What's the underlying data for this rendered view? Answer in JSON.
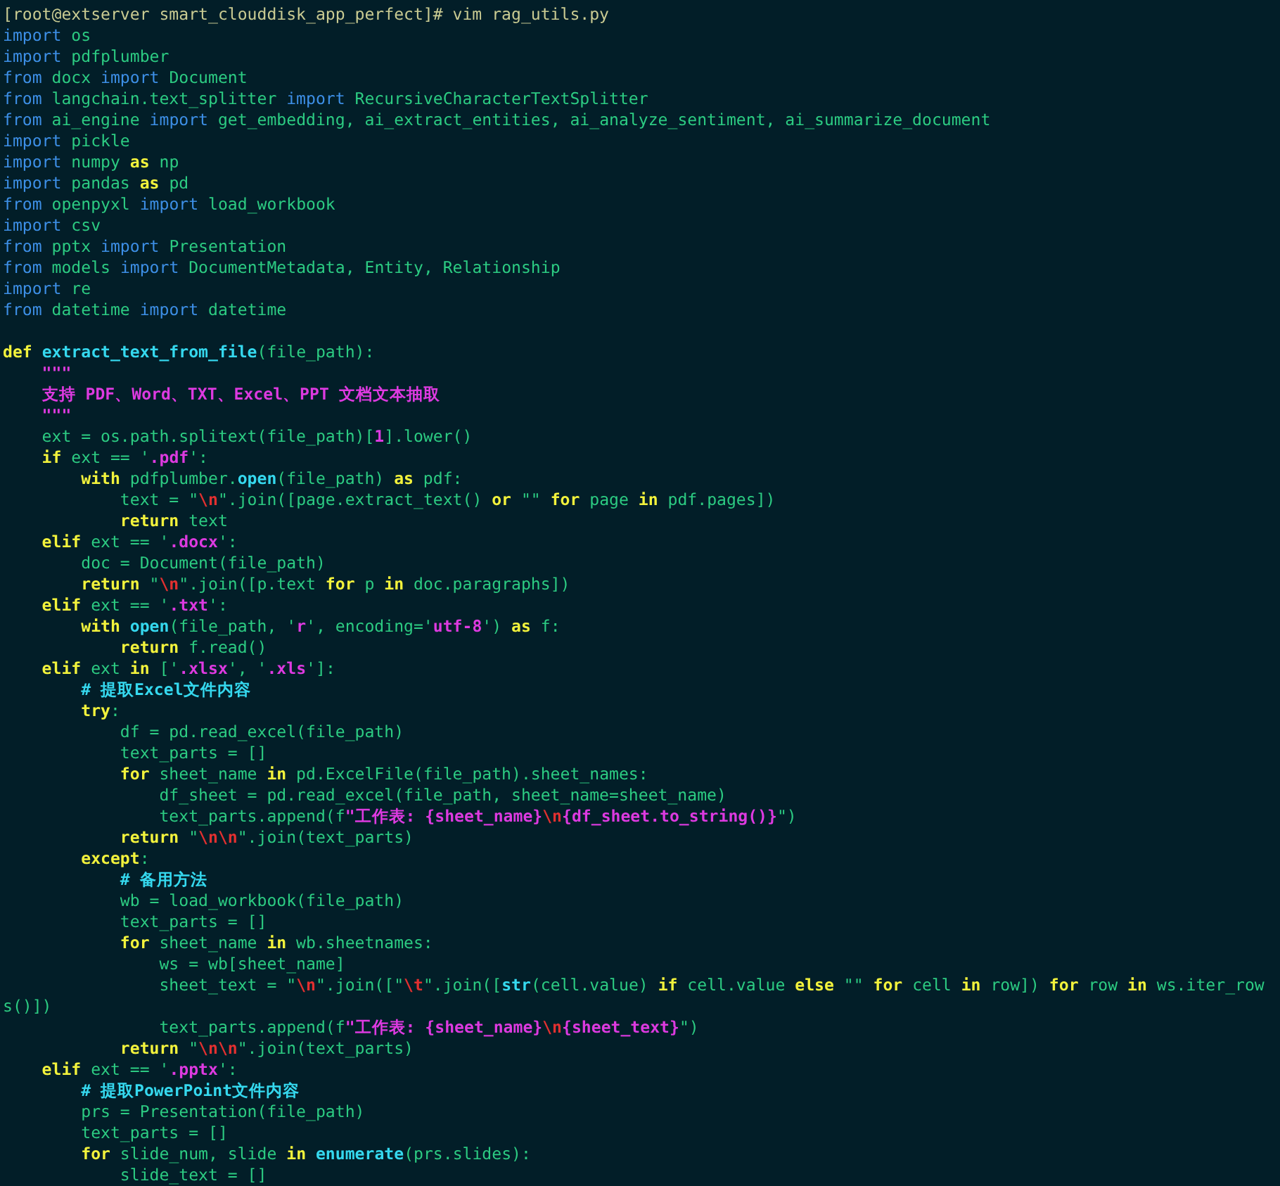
{
  "terminal": {
    "lines": [
      {
        "tokens": [
          {
            "text": "[root@extserver smart_clouddisk_app_perfect]# vim rag_utils.py",
            "kind": "prompt"
          }
        ]
      },
      {
        "tokens": [
          {
            "text": "import",
            "kind": "keyword"
          },
          {
            "text": " os",
            "kind": "plain"
          }
        ]
      },
      {
        "tokens": [
          {
            "text": "import",
            "kind": "keyword"
          },
          {
            "text": " pdfplumber",
            "kind": "plain"
          }
        ]
      },
      {
        "tokens": [
          {
            "text": "from",
            "kind": "keyword"
          },
          {
            "text": " docx ",
            "kind": "plain"
          },
          {
            "text": "import",
            "kind": "keyword"
          },
          {
            "text": " Document",
            "kind": "plain"
          }
        ]
      },
      {
        "tokens": [
          {
            "text": "from",
            "kind": "keyword"
          },
          {
            "text": " langchain.text_splitter ",
            "kind": "plain"
          },
          {
            "text": "import",
            "kind": "keyword"
          },
          {
            "text": " RecursiveCharacterTextSplitter",
            "kind": "plain"
          }
        ]
      },
      {
        "tokens": [
          {
            "text": "from",
            "kind": "keyword"
          },
          {
            "text": " ai_engine ",
            "kind": "plain"
          },
          {
            "text": "import",
            "kind": "keyword"
          },
          {
            "text": " get_embedding, ai_extract_entities, ai_analyze_sentiment, ai_summarize_document",
            "kind": "plain"
          }
        ]
      },
      {
        "tokens": [
          {
            "text": "import",
            "kind": "keyword"
          },
          {
            "text": " pickle",
            "kind": "plain"
          }
        ]
      },
      {
        "tokens": [
          {
            "text": "import",
            "kind": "keyword"
          },
          {
            "text": " numpy ",
            "kind": "plain"
          },
          {
            "text": "as",
            "kind": "statement"
          },
          {
            "text": " np",
            "kind": "plain"
          }
        ]
      },
      {
        "tokens": [
          {
            "text": "import",
            "kind": "keyword"
          },
          {
            "text": " pandas ",
            "kind": "plain"
          },
          {
            "text": "as",
            "kind": "statement"
          },
          {
            "text": " pd",
            "kind": "plain"
          }
        ]
      },
      {
        "tokens": [
          {
            "text": "from",
            "kind": "keyword"
          },
          {
            "text": " openpyxl ",
            "kind": "plain"
          },
          {
            "text": "import",
            "kind": "keyword"
          },
          {
            "text": " load_workbook",
            "kind": "plain"
          }
        ]
      },
      {
        "tokens": [
          {
            "text": "import",
            "kind": "keyword"
          },
          {
            "text": " csv",
            "kind": "plain"
          }
        ]
      },
      {
        "tokens": [
          {
            "text": "from",
            "kind": "keyword"
          },
          {
            "text": " pptx ",
            "kind": "plain"
          },
          {
            "text": "import",
            "kind": "keyword"
          },
          {
            "text": " Presentation",
            "kind": "plain"
          }
        ]
      },
      {
        "tokens": [
          {
            "text": "from",
            "kind": "keyword"
          },
          {
            "text": " models ",
            "kind": "plain"
          },
          {
            "text": "import",
            "kind": "keyword"
          },
          {
            "text": " DocumentMetadata, Entity, Relationship",
            "kind": "plain"
          }
        ]
      },
      {
        "tokens": [
          {
            "text": "import",
            "kind": "keyword"
          },
          {
            "text": " re",
            "kind": "plain"
          }
        ]
      },
      {
        "tokens": [
          {
            "text": "from",
            "kind": "keyword"
          },
          {
            "text": " datetime ",
            "kind": "plain"
          },
          {
            "text": "import",
            "kind": "keyword"
          },
          {
            "text": " datetime",
            "kind": "plain"
          }
        ],
        "blank_line_after": true
      },
      {
        "tokens": [
          {
            "text": "def ",
            "kind": "statement"
          },
          {
            "text": "extract_text_from_file",
            "kind": "function"
          },
          {
            "text": "(file_path):",
            "kind": "plain"
          }
        ]
      },
      {
        "tokens": [
          {
            "text": "    \"\"\"",
            "kind": "string"
          }
        ]
      },
      {
        "tokens": [
          {
            "text": "    支持 PDF、Word、TXT、Excel、PPT 文档文本抽取",
            "kind": "string"
          }
        ]
      },
      {
        "tokens": [
          {
            "text": "    \"\"\"",
            "kind": "string"
          }
        ]
      },
      {
        "tokens": [
          {
            "text": "    ext = os.path.splitext(file_path)[",
            "kind": "plain"
          },
          {
            "text": "1",
            "kind": "string"
          },
          {
            "text": "].lower()",
            "kind": "plain"
          }
        ]
      },
      {
        "tokens": [
          {
            "text": "    if",
            "kind": "statement"
          },
          {
            "text": " ext == '",
            "kind": "plain"
          },
          {
            "text": ".pdf",
            "kind": "string"
          },
          {
            "text": "':",
            "kind": "plain"
          }
        ]
      },
      {
        "tokens": [
          {
            "text": "        with",
            "kind": "statement"
          },
          {
            "text": " pdfplumber.",
            "kind": "plain"
          },
          {
            "text": "open",
            "kind": "function"
          },
          {
            "text": "(file_path) ",
            "kind": "plain"
          },
          {
            "text": "as",
            "kind": "statement"
          },
          {
            "text": " pdf:",
            "kind": "plain"
          }
        ]
      },
      {
        "tokens": [
          {
            "text": "            text = \"",
            "kind": "plain"
          },
          {
            "text": "\\n",
            "kind": "escape"
          },
          {
            "text": "\".join([page.extract_text() ",
            "kind": "plain"
          },
          {
            "text": "or",
            "kind": "statement"
          },
          {
            "text": " \"\" ",
            "kind": "plain"
          },
          {
            "text": "for",
            "kind": "statement"
          },
          {
            "text": " page ",
            "kind": "plain"
          },
          {
            "text": "in",
            "kind": "statement"
          },
          {
            "text": " pdf.pages])",
            "kind": "plain"
          }
        ]
      },
      {
        "tokens": [
          {
            "text": "            return",
            "kind": "statement"
          },
          {
            "text": " text",
            "kind": "plain"
          }
        ]
      },
      {
        "tokens": [
          {
            "text": "    elif",
            "kind": "statement"
          },
          {
            "text": " ext == '",
            "kind": "plain"
          },
          {
            "text": ".docx",
            "kind": "string"
          },
          {
            "text": "':",
            "kind": "plain"
          }
        ]
      },
      {
        "tokens": [
          {
            "text": "        doc = Document(file_path)",
            "kind": "plain"
          }
        ]
      },
      {
        "tokens": [
          {
            "text": "        return",
            "kind": "statement"
          },
          {
            "text": " \"",
            "kind": "plain"
          },
          {
            "text": "\\n",
            "kind": "escape"
          },
          {
            "text": "\".join([p.text ",
            "kind": "plain"
          },
          {
            "text": "for",
            "kind": "statement"
          },
          {
            "text": " p ",
            "kind": "plain"
          },
          {
            "text": "in",
            "kind": "statement"
          },
          {
            "text": " doc.paragraphs])",
            "kind": "plain"
          }
        ]
      },
      {
        "tokens": [
          {
            "text": "    elif",
            "kind": "statement"
          },
          {
            "text": " ext == '",
            "kind": "plain"
          },
          {
            "text": ".txt",
            "kind": "string"
          },
          {
            "text": "':",
            "kind": "plain"
          }
        ]
      },
      {
        "tokens": [
          {
            "text": "        with",
            "kind": "statement"
          },
          {
            "text": " open",
            "kind": "function"
          },
          {
            "text": "(file_path, '",
            "kind": "plain"
          },
          {
            "text": "r",
            "kind": "string"
          },
          {
            "text": "', encoding='",
            "kind": "plain"
          },
          {
            "text": "utf-8",
            "kind": "string"
          },
          {
            "text": "') ",
            "kind": "plain"
          },
          {
            "text": "as",
            "kind": "statement"
          },
          {
            "text": " f:",
            "kind": "plain"
          }
        ]
      },
      {
        "tokens": [
          {
            "text": "            return",
            "kind": "statement"
          },
          {
            "text": " f.read()",
            "kind": "plain"
          }
        ]
      },
      {
        "tokens": [
          {
            "text": "    elif",
            "kind": "statement"
          },
          {
            "text": " ext ",
            "kind": "plain"
          },
          {
            "text": "in",
            "kind": "statement"
          },
          {
            "text": " ['",
            "kind": "plain"
          },
          {
            "text": ".xlsx",
            "kind": "string"
          },
          {
            "text": "', '",
            "kind": "plain"
          },
          {
            "text": ".xls",
            "kind": "string"
          },
          {
            "text": "']:",
            "kind": "plain"
          }
        ]
      },
      {
        "tokens": [
          {
            "text": "        # 提取Excel文件内容",
            "kind": "comment"
          }
        ]
      },
      {
        "tokens": [
          {
            "text": "        try",
            "kind": "statement"
          },
          {
            "text": ":",
            "kind": "plain"
          }
        ]
      },
      {
        "tokens": [
          {
            "text": "            df = pd.read_excel(file_path)",
            "kind": "plain"
          }
        ]
      },
      {
        "tokens": [
          {
            "text": "            text_parts = []",
            "kind": "plain"
          }
        ]
      },
      {
        "tokens": [
          {
            "text": "            for",
            "kind": "statement"
          },
          {
            "text": " sheet_name ",
            "kind": "plain"
          },
          {
            "text": "in",
            "kind": "statement"
          },
          {
            "text": " pd.ExcelFile(file_path).sheet_names:",
            "kind": "plain"
          }
        ]
      },
      {
        "tokens": [
          {
            "text": "                df_sheet = pd.read_excel(file_path, sheet_name=sheet_name)",
            "kind": "plain"
          }
        ]
      },
      {
        "tokens": [
          {
            "text": "                text_parts.append(f",
            "kind": "plain"
          },
          {
            "text": "\"工作表: {sheet_name}",
            "kind": "string"
          },
          {
            "text": "\\n",
            "kind": "escape"
          },
          {
            "text": "{df_sheet.to_string()}",
            "kind": "string"
          },
          {
            "text": "\")",
            "kind": "plain"
          }
        ]
      },
      {
        "tokens": [
          {
            "text": "            return",
            "kind": "statement"
          },
          {
            "text": " \"",
            "kind": "plain"
          },
          {
            "text": "\\n\\n",
            "kind": "escape"
          },
          {
            "text": "\".join(text_parts)",
            "kind": "plain"
          }
        ]
      },
      {
        "tokens": [
          {
            "text": "        except",
            "kind": "statement"
          },
          {
            "text": ":",
            "kind": "plain"
          }
        ]
      },
      {
        "tokens": [
          {
            "text": "            # 备用方法",
            "kind": "comment"
          }
        ]
      },
      {
        "tokens": [
          {
            "text": "            wb = load_workbook(file_path)",
            "kind": "plain"
          }
        ]
      },
      {
        "tokens": [
          {
            "text": "            text_parts = []",
            "kind": "plain"
          }
        ]
      },
      {
        "tokens": [
          {
            "text": "            for",
            "kind": "statement"
          },
          {
            "text": " sheet_name ",
            "kind": "plain"
          },
          {
            "text": "in",
            "kind": "statement"
          },
          {
            "text": " wb.sheetnames:",
            "kind": "plain"
          }
        ]
      },
      {
        "tokens": [
          {
            "text": "                ws = wb[sheet_name]",
            "kind": "plain"
          }
        ]
      },
      {
        "tokens": [
          {
            "text": "                sheet_text = \"",
            "kind": "plain"
          },
          {
            "text": "\\n",
            "kind": "escape"
          },
          {
            "text": "\".join([\"",
            "kind": "plain"
          },
          {
            "text": "\\t",
            "kind": "escape"
          },
          {
            "text": "\".join([",
            "kind": "plain"
          },
          {
            "text": "str",
            "kind": "function"
          },
          {
            "text": "(cell.value) ",
            "kind": "plain"
          },
          {
            "text": "if",
            "kind": "statement"
          },
          {
            "text": " cell.value ",
            "kind": "plain"
          },
          {
            "text": "else",
            "kind": "statement"
          },
          {
            "text": " \"\" ",
            "kind": "plain"
          },
          {
            "text": "for",
            "kind": "statement"
          },
          {
            "text": " cell ",
            "kind": "plain"
          },
          {
            "text": "in",
            "kind": "statement"
          },
          {
            "text": " row]) ",
            "kind": "plain"
          },
          {
            "text": "for",
            "kind": "statement"
          },
          {
            "text": " row ",
            "kind": "plain"
          },
          {
            "text": "in",
            "kind": "statement"
          },
          {
            "text": " ws.iter_row",
            "kind": "plain"
          }
        ]
      },
      {
        "tokens": [
          {
            "text": "s()])",
            "kind": "plain"
          }
        ]
      },
      {
        "tokens": [
          {
            "text": "                text_parts.append(f",
            "kind": "plain"
          },
          {
            "text": "\"工作表: {sheet_name}",
            "kind": "string"
          },
          {
            "text": "\\n",
            "kind": "escape"
          },
          {
            "text": "{sheet_text}",
            "kind": "string"
          },
          {
            "text": "\")",
            "kind": "plain"
          }
        ]
      },
      {
        "tokens": [
          {
            "text": "            return",
            "kind": "statement"
          },
          {
            "text": " \"",
            "kind": "plain"
          },
          {
            "text": "\\n\\n",
            "kind": "escape"
          },
          {
            "text": "\".join(text_parts)",
            "kind": "plain"
          }
        ]
      },
      {
        "tokens": [
          {
            "text": "    elif",
            "kind": "statement"
          },
          {
            "text": " ext == '",
            "kind": "plain"
          },
          {
            "text": ".pptx",
            "kind": "string"
          },
          {
            "text": "':",
            "kind": "plain"
          }
        ]
      },
      {
        "tokens": [
          {
            "text": "        # 提取PowerPoint文件内容",
            "kind": "comment"
          }
        ]
      },
      {
        "tokens": [
          {
            "text": "        prs = Presentation(file_path)",
            "kind": "plain"
          }
        ]
      },
      {
        "tokens": [
          {
            "text": "        text_parts = []",
            "kind": "plain"
          }
        ]
      },
      {
        "tokens": [
          {
            "text": "        for",
            "kind": "statement"
          },
          {
            "text": " slide_num, slide ",
            "kind": "plain"
          },
          {
            "text": "in",
            "kind": "statement"
          },
          {
            "text": " enumerate",
            "kind": "function"
          },
          {
            "text": "(prs.slides):",
            "kind": "plain"
          }
        ]
      },
      {
        "tokens": [
          {
            "text": "            slide_text = []",
            "kind": "plain"
          }
        ]
      }
    ]
  }
}
